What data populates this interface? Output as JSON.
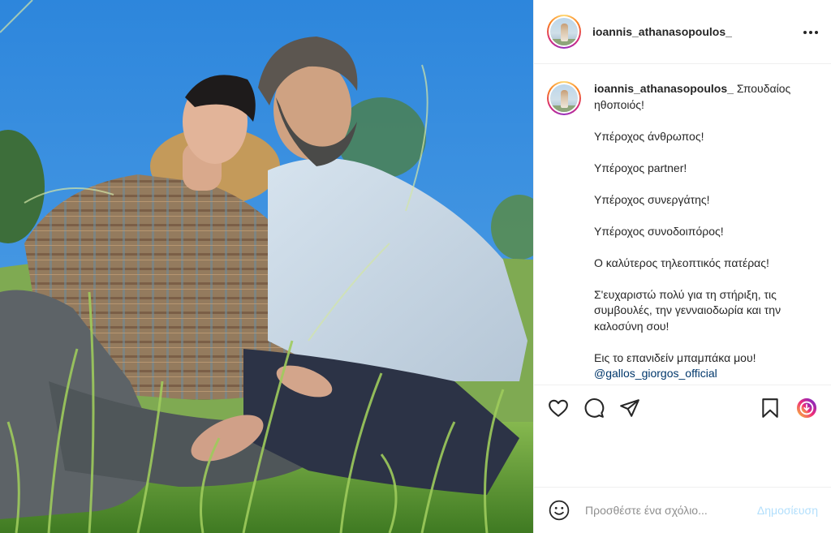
{
  "post": {
    "username": "ioannis_athanasopoulos_",
    "more_label": "More options",
    "caption": {
      "user": "ioannis_athanasopoulos_",
      "lines": {
        "l1": "Σπουδαίος ηθοποιός!",
        "l2": "Υπέροχος άνθρωπος!",
        "l3": "Υπέροχος partner!",
        "l4": "Υπέροχος συνεργάτης!",
        "l5": "Υπέροχος συνοδοιπόρος!",
        "l6": "Ο καλύτερος τηλεοπτικός πατέρας!",
        "l7": "Σ'ευχαριστώ πολύ για τη στήριξη, τις συμβουλές, την γενναιοδωρία και την καλοσύνη σου!",
        "l8": "Εις το επανιδείν μπαμπάκα μου!",
        "mention": "@gallos_giorgos_official"
      }
    },
    "actions": {
      "like_icon": "heart-icon",
      "comment_icon": "comment-bubble-icon",
      "share_icon": "paper-plane-icon",
      "save_icon": "bookmark-icon",
      "reel_icon": "gradient-circle-icon"
    },
    "comment": {
      "placeholder": "Προσθέστε ένα σχόλιο...",
      "post_label": "Δημοσίευση",
      "emoji_icon": "smiley-icon"
    }
  },
  "colors": {
    "text": "#262626",
    "border": "#efefef",
    "mention": "#00376b",
    "post_button_disabled": "#b2dffc",
    "placeholder": "#8e8e8e",
    "sky": "#3b8fdc"
  }
}
